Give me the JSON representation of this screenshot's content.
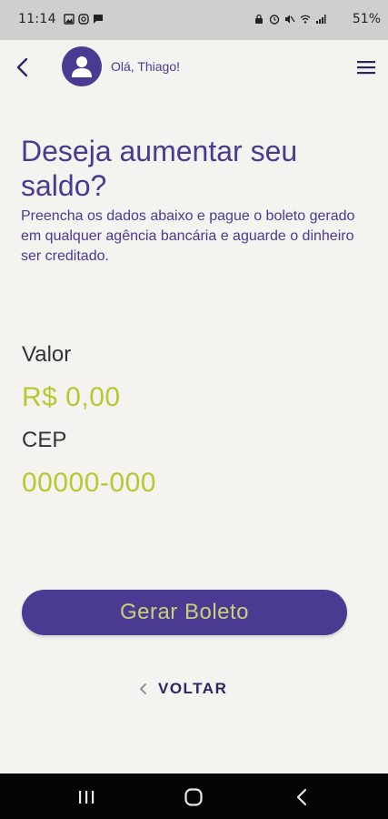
{
  "status_bar": {
    "time": "11:14",
    "battery_text": "51%",
    "left_icons": [
      "gallery-icon",
      "instagram-icon",
      "message-icon"
    ],
    "right_icons": [
      "lock-icon",
      "alarm-icon",
      "mute-icon",
      "wifi-icon",
      "signal-icon"
    ]
  },
  "header": {
    "greeting": "Olá, Thiago!",
    "back_icon": "chevron-left-icon",
    "avatar_icon": "user-icon",
    "menu_icon": "hamburger-menu-icon"
  },
  "page": {
    "title": "Deseja aumentar seu saldo?",
    "subtitle": "Preencha os dados abaixo e pague o boleto gerado em qualquer agência bancária e aguarde o dinheiro ser creditado."
  },
  "form": {
    "valor_label": "Valor",
    "valor_value": "R$ 0,00",
    "cep_label": "CEP",
    "cep_value": "00000-000"
  },
  "actions": {
    "generate_label": "Gerar Boleto",
    "back_label": "VOLTAR"
  },
  "colors": {
    "primary": "#4a3a92",
    "accent": "#b6c930",
    "background": "#f4f3f0"
  }
}
